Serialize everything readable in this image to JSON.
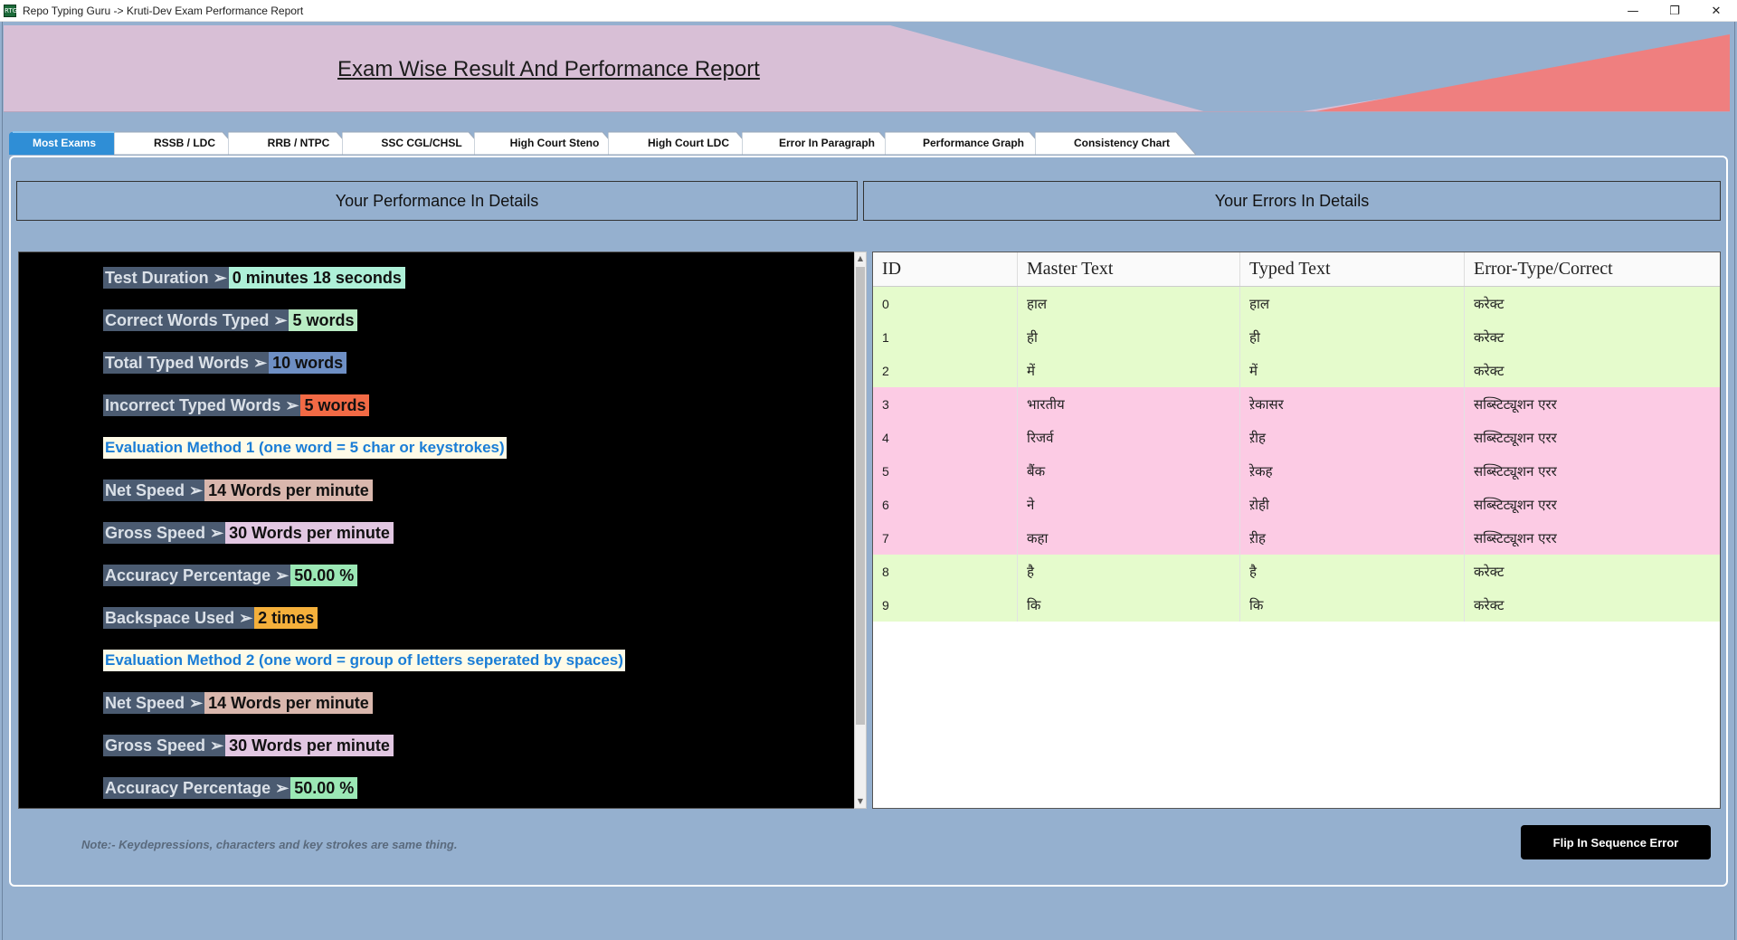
{
  "window": {
    "title": "Repo Typing Guru -> Kruti-Dev Exam Performance Report",
    "icon_text": "RTG",
    "minimize_glyph": "—",
    "restore_glyph": "❐",
    "close_glyph": "✕"
  },
  "banner": {
    "title": "Exam Wise Result And Performance Report",
    "colors": {
      "base": "#d8bfd6",
      "blue": "#95b0cf",
      "red": "#ef7f7f"
    }
  },
  "tabs": [
    {
      "label": "Most Exams",
      "active": true
    },
    {
      "label": "RSSB / LDC",
      "active": false
    },
    {
      "label": "RRB / NTPC",
      "active": false
    },
    {
      "label": "SSC CGL/CHSL",
      "active": false
    },
    {
      "label": "High Court Steno",
      "active": false
    },
    {
      "label": "High Court LDC",
      "active": false
    },
    {
      "label": "Error In Paragraph",
      "active": false
    },
    {
      "label": "Performance Graph",
      "active": false
    },
    {
      "label": "Consistency Chart",
      "active": false
    }
  ],
  "sections": {
    "performance_title": "Your Performance In Details",
    "errors_title": "Your Errors In Details"
  },
  "performance": {
    "test_duration": {
      "label": "Test Duration ➢",
      "value": "0 minutes 18 seconds",
      "color": "#aef0d8"
    },
    "correct_words": {
      "label": "Correct Words Typed ➢",
      "value": "5  words",
      "color": "#b9ecc4"
    },
    "total_words": {
      "label": "Total Typed Words ➢",
      "value": "10  words",
      "color": "#6e8fc4"
    },
    "incorrect_words": {
      "label": "Incorrect Typed Words ➢",
      "value": "5  words",
      "color": "#f26a45"
    },
    "method1": "Evaluation Method 1 (one word = 5 char or keystrokes)",
    "m1_net_speed": {
      "label": "Net Speed ➢",
      "value": "14 Words per minute",
      "color": "#d9b7ad"
    },
    "m1_gross_speed": {
      "label": "Gross Speed ➢",
      "value": "30 Words per minute",
      "color": "#e2c7e2"
    },
    "m1_accuracy": {
      "label": "Accuracy Percentage ➢",
      "value": "50.00 %",
      "color": "#9be8b5"
    },
    "backspace": {
      "label": "Backspace Used ➢",
      "value": "2 times",
      "color": "#f5b03b"
    },
    "method2": "Evaluation Method 2 (one word = group of letters seperated by spaces)",
    "m2_net_speed": {
      "label": "Net Speed ➢",
      "value": "14 Words per minute",
      "color": "#d9b7ad"
    },
    "m2_gross_speed": {
      "label": "Gross Speed ➢",
      "value": "30 Words per minute",
      "color": "#e2c7e2"
    },
    "m2_accuracy": {
      "label": "Accuracy Percentage ➢",
      "value": "50.00 %",
      "color": "#9be8b5"
    }
  },
  "errors_table": {
    "columns": [
      "ID",
      "Master Text",
      "Typed Text",
      "Error-Type/Correct"
    ],
    "rows": [
      {
        "id": "0",
        "master": "हाल",
        "typed": "हाल",
        "status": "करेक्ट",
        "ok": true
      },
      {
        "id": "1",
        "master": "ही",
        "typed": "ही",
        "status": "करेक्ट",
        "ok": true
      },
      {
        "id": "2",
        "master": "में",
        "typed": "में",
        "status": "करेक्ट",
        "ok": true
      },
      {
        "id": "3",
        "master": "भारतीय",
        "typed": "ऱेकासर",
        "status": "सब्स्टिट्यूशन एरर",
        "ok": false
      },
      {
        "id": "4",
        "master": "रिजर्व",
        "typed": "ऱीह",
        "status": "सब्स्टिट्यूशन एरर",
        "ok": false
      },
      {
        "id": "5",
        "master": "बैंक",
        "typed": "ऱेकह",
        "status": "सब्स्टिट्यूशन एरर",
        "ok": false
      },
      {
        "id": "6",
        "master": "ने",
        "typed": "ऱोही",
        "status": "सब्स्टिट्यूशन एरर",
        "ok": false
      },
      {
        "id": "7",
        "master": "कहा",
        "typed": "ऱीह",
        "status": "सब्स्टिट्यूशन एरर",
        "ok": false
      },
      {
        "id": "8",
        "master": "है",
        "typed": "है",
        "status": "करेक्ट",
        "ok": true
      },
      {
        "id": "9",
        "master": "कि",
        "typed": "कि",
        "status": "करेक्ट",
        "ok": true
      }
    ]
  },
  "footer": {
    "note": "Note:- Keydepressions, characters and key strokes are same thing.",
    "flip_button": "Flip In Sequence Error"
  }
}
